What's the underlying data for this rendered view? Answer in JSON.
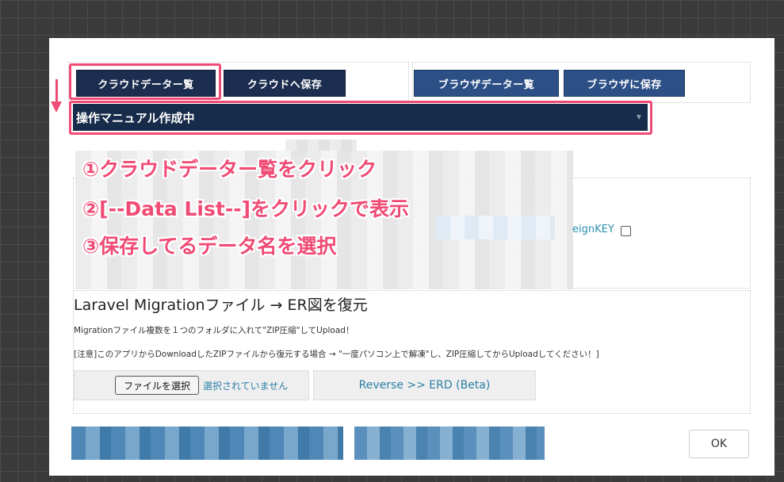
{
  "toolbar": {
    "cloud_list_label": "クラウドデーター覧",
    "cloud_save_label": "クラウドへ保存",
    "browser_list_label": "ブラウザデーター覧",
    "browser_save_label": "ブラウザに保存"
  },
  "select": {
    "value": "操作マニュアル作成中"
  },
  "annotations": {
    "step1": "①クラウドデーター覧をクリック",
    "step2": "②[--Data List--]をクリックで表示",
    "step3": "③保存してるデータ名を選択"
  },
  "foreign_key_label": "eignKEY",
  "migration": {
    "title": "Laravel Migrationファイル → ER図を復元",
    "description": "Migrationファイル複数を１つのフォルダに入れて\"ZIP圧縮\"してUpload！",
    "note": "[注意]このアプリからDownloadしたZIPファイルから復元する場合 → \"一度パソコン上で解凍\"し、ZIP圧縮してからUploadしてください！]",
    "file_button_label": "ファイルを選択",
    "file_status": "選択されていません",
    "reverse_button_label": "Reverse >> ERD (Beta)"
  },
  "ok_label": "OK",
  "colors": {
    "accent_pink": "#ef4b74",
    "navy": "#1c2e4f",
    "blue": "#2c4f86",
    "link": "#2a7fa5"
  }
}
